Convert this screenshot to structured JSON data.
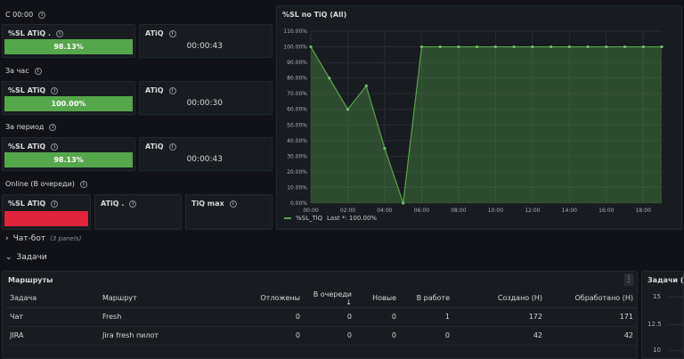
{
  "sections": {
    "s1": "С 00:00",
    "s2": "За час",
    "s3": "За период",
    "s4": "Online (В очереди)"
  },
  "stats": {
    "row1": {
      "sl_title": "%SL ATiQ .",
      "sl_value": "98.13%",
      "atiq_title": "ATiQ",
      "atiq_value": "00:00:43"
    },
    "row2": {
      "sl_title": "%SL ATiQ",
      "sl_value": "100.00%",
      "atiq_title": "ATiQ",
      "atiq_value": "00:00:30"
    },
    "row3": {
      "sl_title": "%SL ATiQ",
      "sl_value": "98.13%",
      "atiq_title": "ATiQ",
      "atiq_value": "00:00:43"
    },
    "row4": {
      "sl_title": "%SL ATiQ",
      "atiq_title": "ATiQ .",
      "tiqmax_title": "TiQ max"
    }
  },
  "chat_row": {
    "label": "Чат-бот",
    "sub": "(3 panels)"
  },
  "tasks_row": {
    "label": "Задачи"
  },
  "routes": {
    "title": "Маршруты",
    "columns": [
      "Задача",
      "Маршрут",
      "Отложены",
      "В очереди",
      "Новые",
      "В работе",
      "Создано (Н)",
      "Обработано (Н)"
    ],
    "sort_icon": "↓",
    "rows": [
      [
        "Чат",
        "Fresh",
        "0",
        "0",
        "0",
        "1",
        "172",
        "171"
      ],
      [
        "JIRA",
        "Jira fresh пилот",
        "0",
        "0",
        "0",
        "0",
        "42",
        "42"
      ]
    ]
  },
  "side_panel": {
    "title": "Задачи (All",
    "ticks": [
      "15",
      "12.5",
      "10"
    ]
  },
  "chart_data": {
    "type": "area",
    "title": "%SL по TiQ (All)",
    "x": [
      "00:00",
      "01:00",
      "02:00",
      "03:00",
      "04:00",
      "05:00",
      "06:00",
      "07:00",
      "08:00",
      "09:00",
      "10:00",
      "11:00",
      "12:00",
      "13:00",
      "14:00",
      "15:00",
      "16:00",
      "17:00",
      "18:00",
      "19:00"
    ],
    "x_ticks": [
      "00:00",
      "02:00",
      "04:00",
      "06:00",
      "08:00",
      "10:00",
      "12:00",
      "14:00",
      "16:00",
      "18:00"
    ],
    "series": [
      {
        "name": "%SL_TiQ",
        "values": [
          100,
          80,
          60,
          75,
          35,
          0,
          100,
          100,
          100,
          100,
          100,
          100,
          100,
          100,
          100,
          100,
          100,
          100,
          100,
          100
        ]
      }
    ],
    "y_ticks": [
      "0.00%",
      "10.00%",
      "20.00%",
      "30.00%",
      "40.00%",
      "50.00%",
      "60.00%",
      "70.00%",
      "80.00%",
      "90.00%",
      "100.00%",
      "110.00%"
    ],
    "ylim": [
      0,
      110
    ],
    "legend": {
      "label": "%SL_TiQ",
      "stat": "Last *: 100.00%"
    },
    "color": "#56a64b"
  }
}
